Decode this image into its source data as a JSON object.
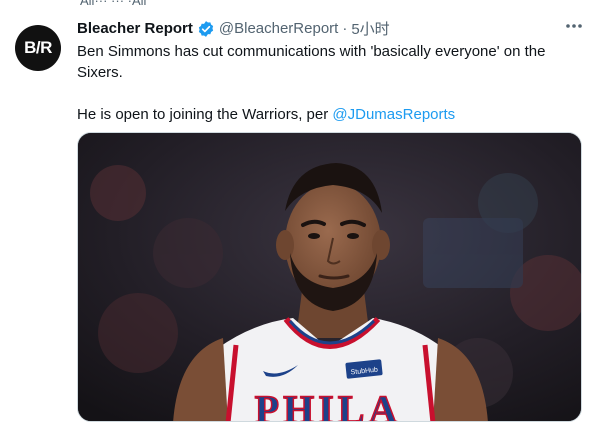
{
  "tweet": {
    "context_clip": "Ali··· ··· ·Ali",
    "author_name": "Bleacher Report",
    "handle": "@BleacherReport",
    "separator": "·",
    "time": "5小时",
    "avatar_text": "B/R",
    "line1": "Ben Simmons has cut communications with 'basically everyone' on the Sixers.",
    "line2_prefix": "He is open to joining the Warriors, per ",
    "mention": "@JDumasReports",
    "more_icon": "more-horizontal-icon",
    "verified_icon": "verified-badge-icon"
  },
  "image": {
    "jersey_text": "PHILA",
    "sponsor_patch": "StubHub",
    "subject": "basketball player in white 76ers jersey",
    "colors": {
      "jersey_trim": "#c8102e",
      "jersey_blue": "#1d428a",
      "accent": "#1d9bf0"
    }
  }
}
